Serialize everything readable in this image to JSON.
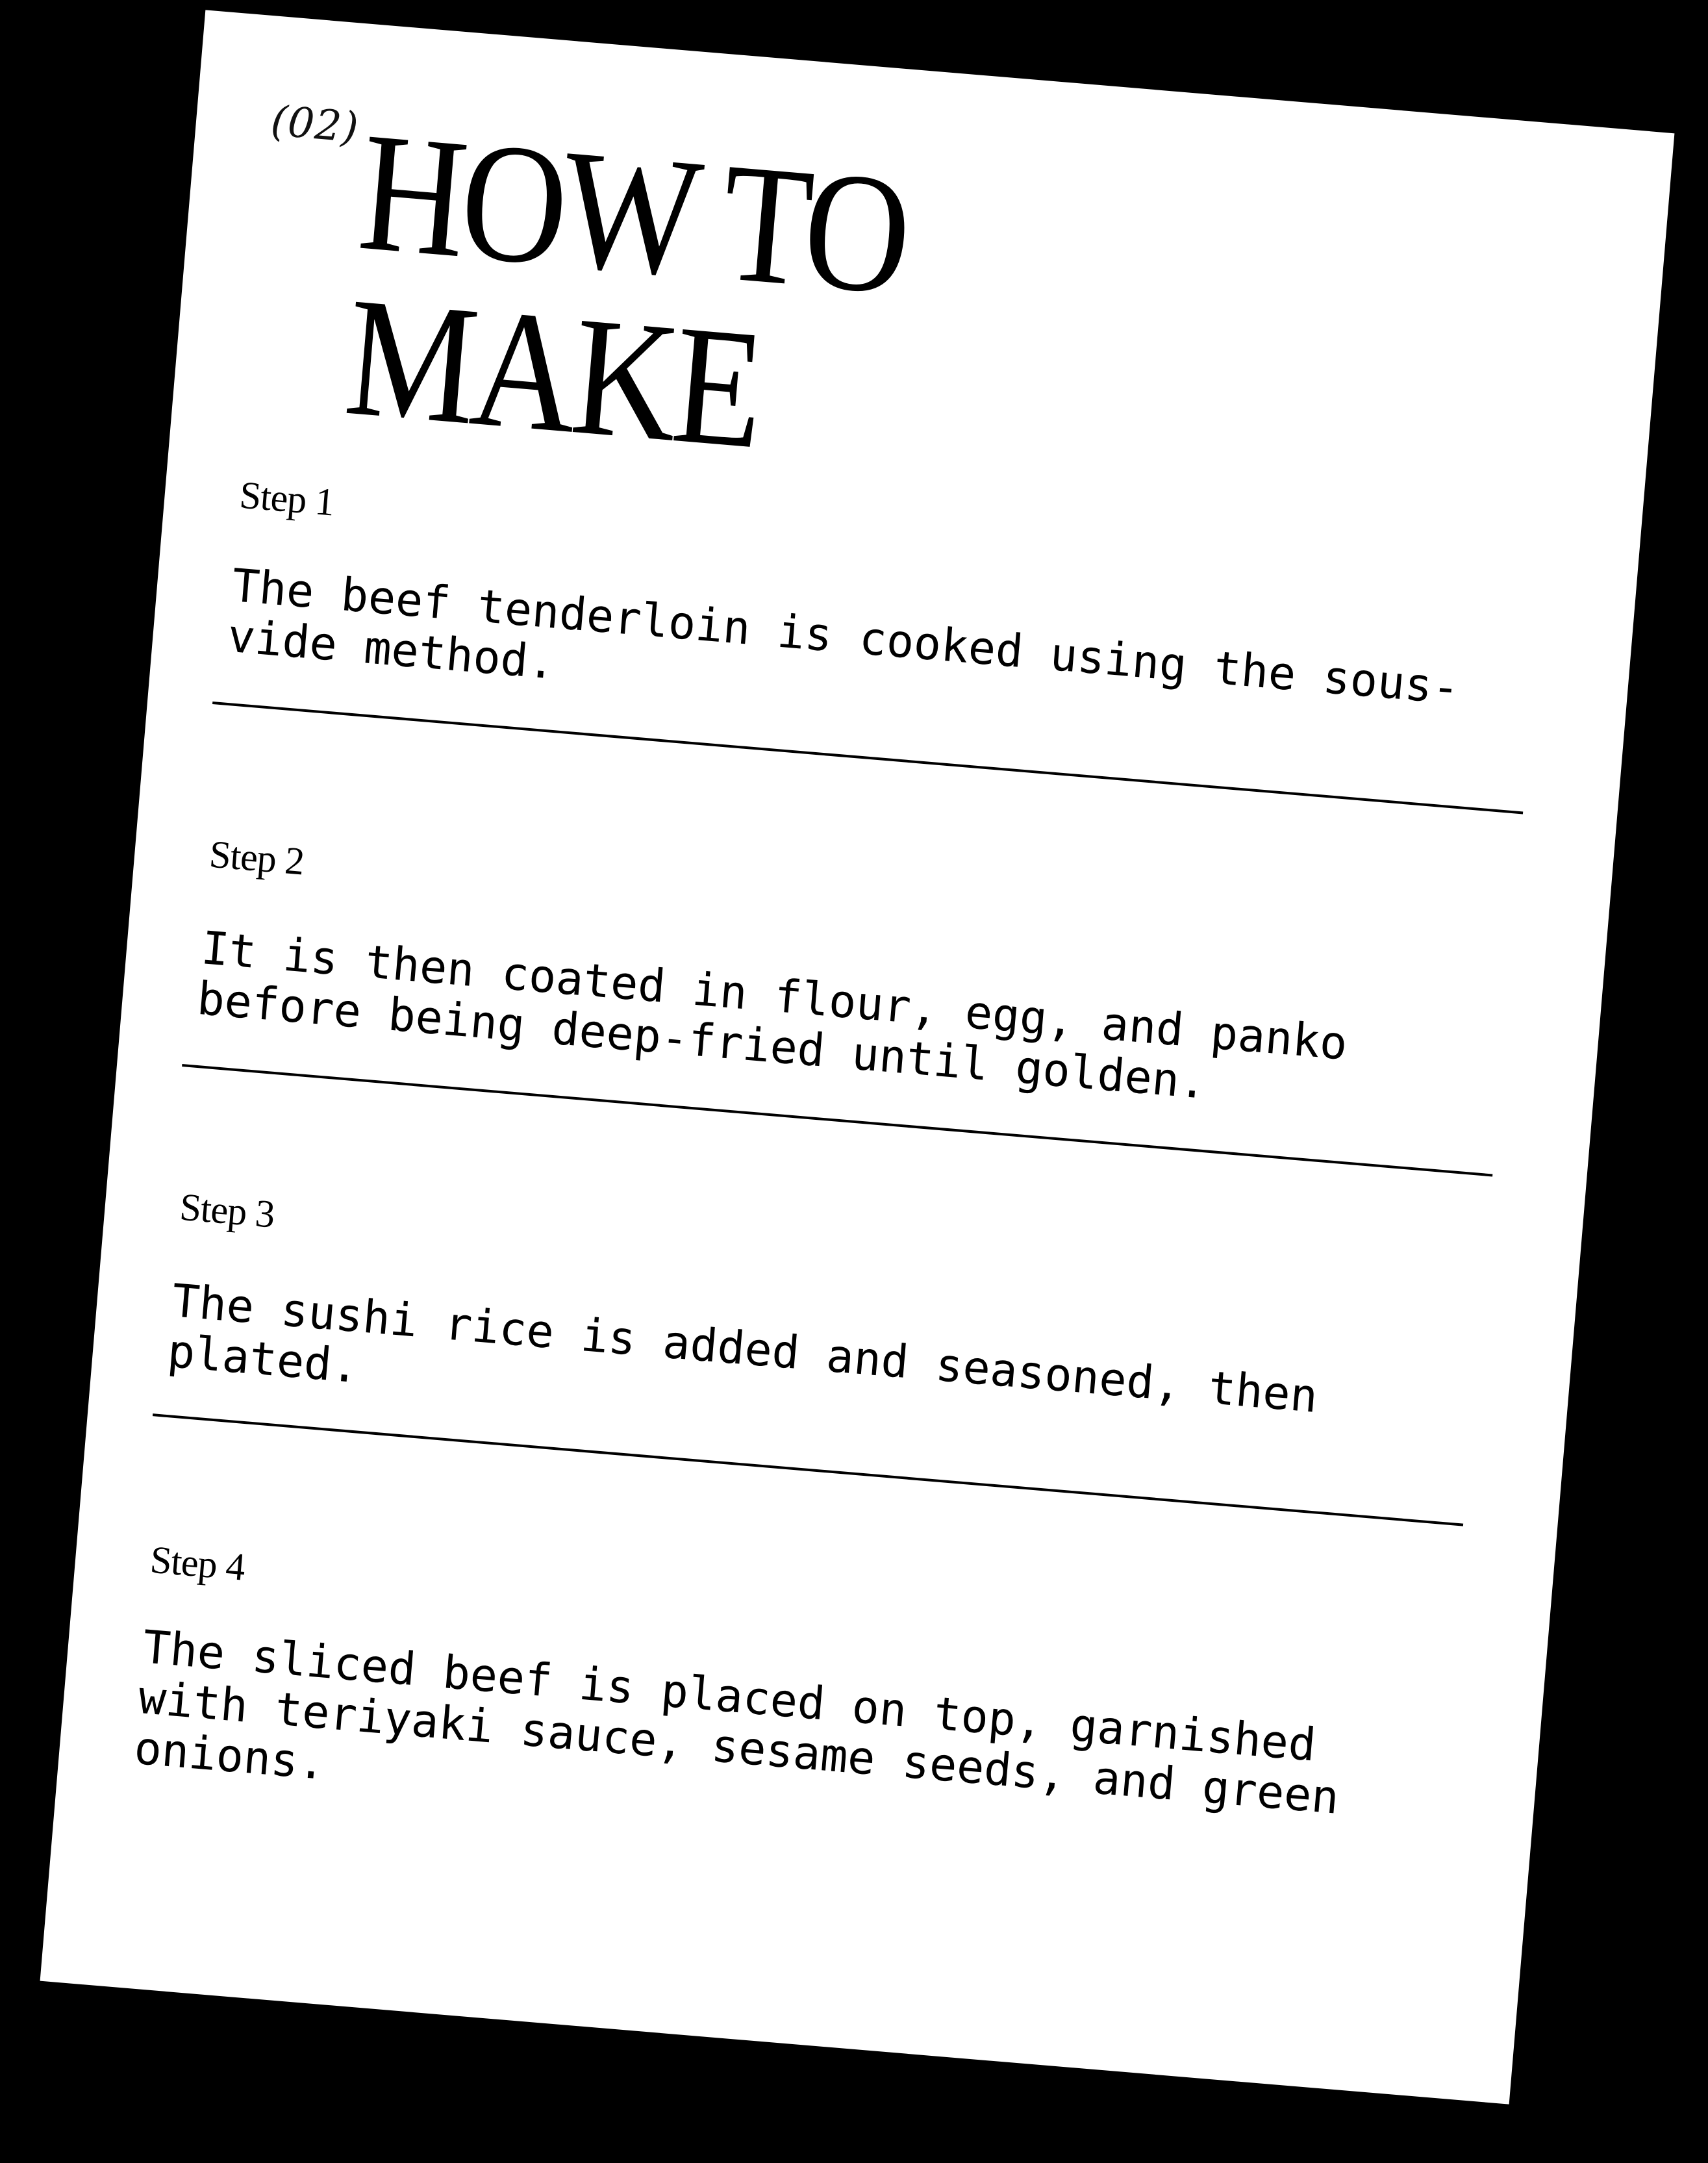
{
  "heading": {
    "number": "(02)",
    "title_line1": "HOW TO",
    "title_line2": "MAKE"
  },
  "steps": [
    {
      "label": "Step 1",
      "text": "The beef tenderloin is cooked using the sous-vide method."
    },
    {
      "label": "Step 2",
      "text": "It is then coated in flour, egg, and panko before being deep-fried until golden."
    },
    {
      "label": "Step 3",
      "text": "The sushi rice is added and seasoned, then plated."
    },
    {
      "label": "Step 4",
      "text": "The sliced beef is placed on top, garnished with teriyaki sauce, sesame seeds, and green onions."
    }
  ]
}
